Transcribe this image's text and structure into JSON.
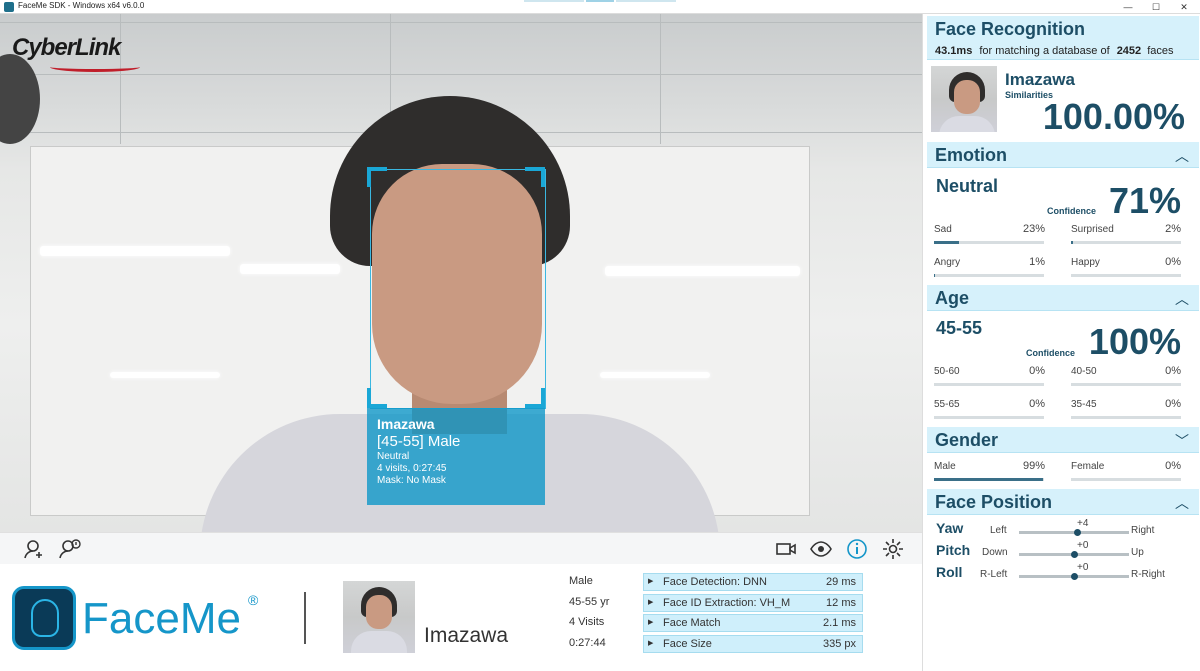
{
  "window": {
    "title": "FaceMe SDK - Windows x64 v6.0.0"
  },
  "camera": {
    "brand_logo": "CyberLink",
    "label": {
      "name": "Imazawa",
      "age_gender": "[45-55] Male",
      "emotion": "Neutral",
      "visits": "4 visits, 0:27:45",
      "mask": "Mask: No Mask"
    }
  },
  "toolbar": {
    "left_icons": [
      "add-face-icon",
      "manage-faces-icon"
    ],
    "right_icons": [
      "camera-icon",
      "eye-icon",
      "info-icon",
      "settings-icon"
    ]
  },
  "bottom": {
    "logo_text": "FaceMe",
    "logo_reg": "®",
    "name": "Imazawa",
    "attrs": {
      "gender": "Male",
      "age": "45-55 yr",
      "visits": "4 Visits",
      "time": "0:27:44"
    },
    "perf": [
      {
        "label": "Face Detection: DNN",
        "value": "29 ms"
      },
      {
        "label": "Face ID Extraction: VH_M",
        "value": "12 ms"
      },
      {
        "label": "Face Match",
        "value": "2.1 ms"
      },
      {
        "label": "Face Size",
        "value": "335 px"
      }
    ]
  },
  "panel": {
    "recognition": {
      "title": "Face Recognition",
      "time": "43.1ms",
      "desc": "for matching a database of",
      "db_count": "2452",
      "faces_word": "faces",
      "name": "Imazawa",
      "sim_label": "Similarities",
      "sim_value": "100.00%"
    },
    "emotion": {
      "title": "Emotion",
      "top": "Neutral",
      "conf_label": "Confidence",
      "conf_value": "71%",
      "stats": [
        {
          "label": "Sad",
          "value": "23%",
          "level": 0.23
        },
        {
          "label": "Surprised",
          "value": "2%",
          "level": 0.02
        },
        {
          "label": "Angry",
          "value": "1%",
          "level": 0.01
        },
        {
          "label": "Happy",
          "value": "0%",
          "level": 0
        }
      ]
    },
    "age": {
      "title": "Age",
      "top": "45-55",
      "conf_label": "Confidence",
      "conf_value": "100%",
      "stats": [
        {
          "label": "50-60",
          "value": "0%",
          "level": 0
        },
        {
          "label": "40-50",
          "value": "0%",
          "level": 0
        },
        {
          "label": "55-65",
          "value": "0%",
          "level": 0
        },
        {
          "label": "35-45",
          "value": "0%",
          "level": 0
        }
      ]
    },
    "gender": {
      "title": "Gender",
      "stats": [
        {
          "label": "Male",
          "value": "99%",
          "level": 0.99
        },
        {
          "label": "Female",
          "value": "0%",
          "level": 0
        }
      ]
    },
    "position": {
      "title": "Face Position",
      "rows": [
        {
          "name": "Yaw",
          "left": "Left",
          "value": "+4",
          "right": "Right",
          "level": 0.53
        },
        {
          "name": "Pitch",
          "left": "Down",
          "value": "+0",
          "right": "Up",
          "level": 0.5
        },
        {
          "name": "Roll",
          "left": "R-Left",
          "value": "+0",
          "right": "R-Right",
          "level": 0.5
        }
      ]
    }
  }
}
